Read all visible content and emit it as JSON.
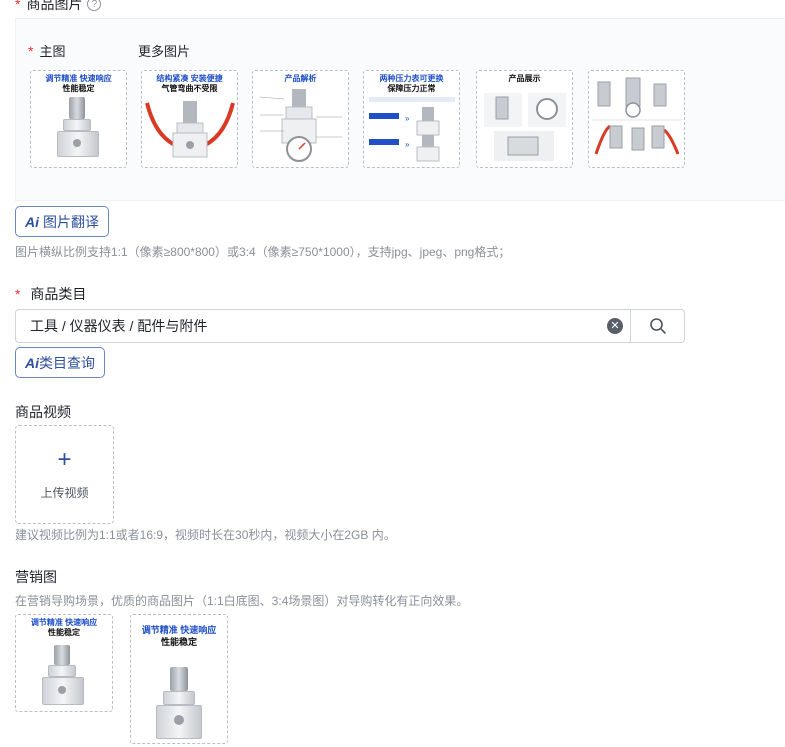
{
  "images_section": {
    "title": "商品图片",
    "help_icon": "?",
    "main_label": "主图",
    "more_label": "更多图片",
    "thumbs": [
      {
        "line1": "调节精准 快速响应",
        "line2": "性能稳定"
      },
      {
        "line1": "结构紧凑 安装便捷",
        "line2": "气管弯曲不受限"
      },
      {
        "line1": "产品解析",
        "line2": ""
      },
      {
        "line1": "两种压力表可更换",
        "line2": "保障压力正常"
      },
      {
        "line1": "产品展示",
        "line2": ""
      },
      {
        "line1": "",
        "line2": ""
      }
    ],
    "ai_translate": "图片翻译",
    "ai_mark": "Ai",
    "hint": "图片横纵比例支持1:1（像素≥800*800）或3:4（像素≥750*1000），支持jpg、jpeg、png格式；"
  },
  "category": {
    "title": "商品类目",
    "value": "工具 / 仪器仪表 / 配件与附件",
    "ai_query": "类目查询",
    "ai_mark": "Ai"
  },
  "video": {
    "title": "商品视频",
    "plus": "+",
    "upload": "上传视频",
    "hint": "建议视频比例为1:1或者16:9，视频时长在30秒内，视频大小在2GB 内。"
  },
  "marketing": {
    "title": "营销图",
    "hint": "在营销导购场景，优质的商品图片（1:1白底图、3:4场景图）对导购转化有正向效果。",
    "thumbs": [
      {
        "line1": "调节精准 快速响应",
        "line2": "性能稳定"
      },
      {
        "line1": "调节精准 快速响应",
        "line2": "性能稳定"
      }
    ]
  },
  "colors": {
    "accent": "#2e4f9e",
    "required": "#e8322c",
    "hint": "#8a8f99"
  },
  "icons": [
    "help-icon",
    "ai-icon",
    "clear-icon",
    "search-icon",
    "plus-icon"
  ]
}
